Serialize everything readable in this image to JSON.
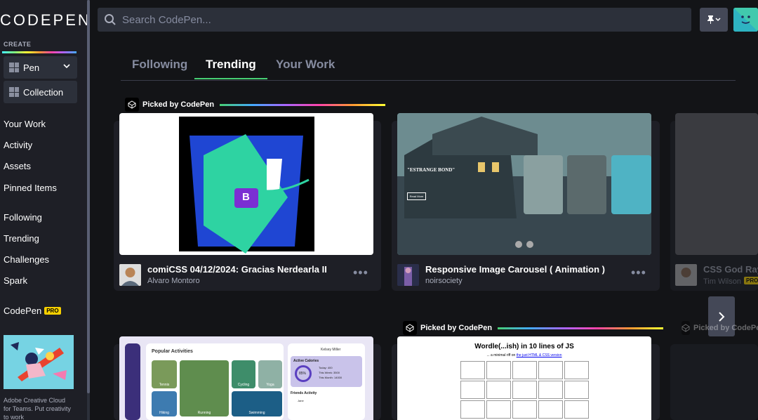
{
  "brand": {
    "logo": "CODEPEN"
  },
  "sidebar": {
    "create_label": "CREATE",
    "pen_label": "Pen",
    "collection_label": "Collection",
    "nav_group_1": [
      "Your Work",
      "Activity",
      "Assets",
      "Pinned Items"
    ],
    "nav_group_2": [
      "Following",
      "Trending",
      "Challenges",
      "Spark"
    ],
    "codepen_label": "CodePen",
    "pro_badge": "PRO",
    "ad_text": "Adobe Creative Cloud for Teams. Put creativity to work"
  },
  "search": {
    "placeholder": "Search CodePen..."
  },
  "tabs": [
    {
      "label": "Following",
      "active": false
    },
    {
      "label": "Trending",
      "active": true
    },
    {
      "label": "Your Work",
      "active": false
    }
  ],
  "picked_label": "Picked by CodePen",
  "cards": [
    {
      "title": "comiCSS 04/12/2024: Gracias Nerdearla II",
      "author": "Alvaro Montoro",
      "preview_badge": "B"
    },
    {
      "title": "Responsive Image Carousel ( Animation )",
      "author": "noirsociety",
      "preview_heading": "\"ESTRANGE BOND\"",
      "preview_button": "Read More"
    },
    {
      "title": "CSS God Rays",
      "author": "Tim Wilson",
      "pro_badge": "PRO"
    }
  ],
  "lower_cards": {
    "dashboard": {
      "section": "Popular Activities",
      "tiles": [
        "Tennis",
        "Running",
        "Cycling",
        "Yoga",
        "Hiking",
        "Swimming"
      ],
      "user": "Kelsey Miller",
      "calories_title": "Active Calories",
      "calories_pct": "85%",
      "today": "Today: 400",
      "week": "This Week: 3500",
      "month": "This Month: 14000",
      "friends_title": "Friends Activity",
      "friend": "Jane"
    },
    "wordle": {
      "title": "Wordle(...ish) in 10 lines of JS",
      "subtitle_before": "... a minimal riff on",
      "subtitle_link": "the just HTML & CSS version",
      "rows": 3,
      "cols": 5
    },
    "third_picked": "Picked by CodePen"
  },
  "colors": {
    "accent": "#47cf73",
    "sidebar_bg": "#1e1f26",
    "page_bg": "#131417",
    "pro": "#f7d000"
  }
}
